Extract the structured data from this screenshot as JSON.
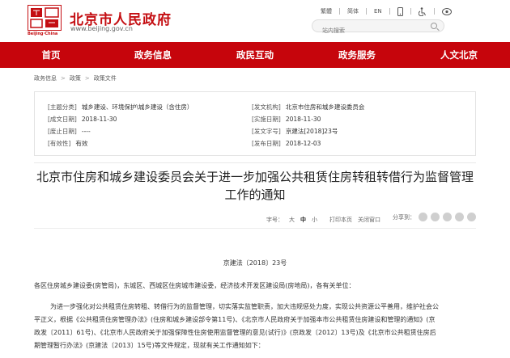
{
  "header": {
    "logo_tag": "Beijing·China",
    "title": "北京市人民政府",
    "url": "www.beijing.gov.cn",
    "tools": [
      "繁體",
      "简体",
      "EN"
    ],
    "search_placeholder": "站内搜索"
  },
  "nav": [
    "首页",
    "政务信息",
    "政民互动",
    "政务服务",
    "人文北京"
  ],
  "breadcrumb": [
    "政务信息",
    "政策",
    "政策文件"
  ],
  "meta": {
    "subject_key": "[主题分类]",
    "subject_val": "城乡建设、环境保护\\城乡建设（含住房）",
    "issuer_key": "[发文机构]",
    "issuer_val": "北京市住房和城乡建设委员会",
    "created_key": "[成文日期]",
    "created_val": "2018-11-30",
    "impl_key": "[实施日期]",
    "impl_val": "2018-11-30",
    "repeal_key": "[废止日期]",
    "repeal_val": "----",
    "docno_key": "[发文字号]",
    "docno_val": "京建法[2018]23号",
    "valid_key": "[有效性]",
    "valid_val": "有效",
    "publish_key": "[发布日期]",
    "publish_val": "2018-12-03"
  },
  "title": "北京市住房和城乡建设委员会关于进一步加强公共租赁住房转租转借行为监督管理工作的通知",
  "font_tools": {
    "label": "字号：",
    "large": "大",
    "medium": "中",
    "small": "小",
    "print": "打印本页",
    "close": "关闭窗口"
  },
  "share_label": "分享到：",
  "doc_number": "京建法〔2018〕23号",
  "body": {
    "salutation": "各区住房城乡建设委(房管局)，东城区、西城区住房城市建设委，经济技术开发区建设局(房地局)，各有关单位：",
    "p1_line1": "为进一步强化对公共租赁住房转租、转借行为的监督管理，切实落实监管职责，加大违规惩处力度，实现公共资源公平善用，维护社会公",
    "p1_line2": "平正义，根据《公共租赁住房管理办法》(住房和城乡建设部令第11号)、《北京市人民政府关于加强本市公共租赁住房建设和管理的通知》(京",
    "p1_line3": "政发〔2011〕61号)、《北京市人民政府关于加强保障性住房使用监督管理的意见(试行)》(京政发〔2012〕13号)及《北京市公共租赁住房后",
    "p1_line4": "期管理暂行办法》(京建法〔2013〕15号)等文件规定，现就有关工作通知如下："
  }
}
